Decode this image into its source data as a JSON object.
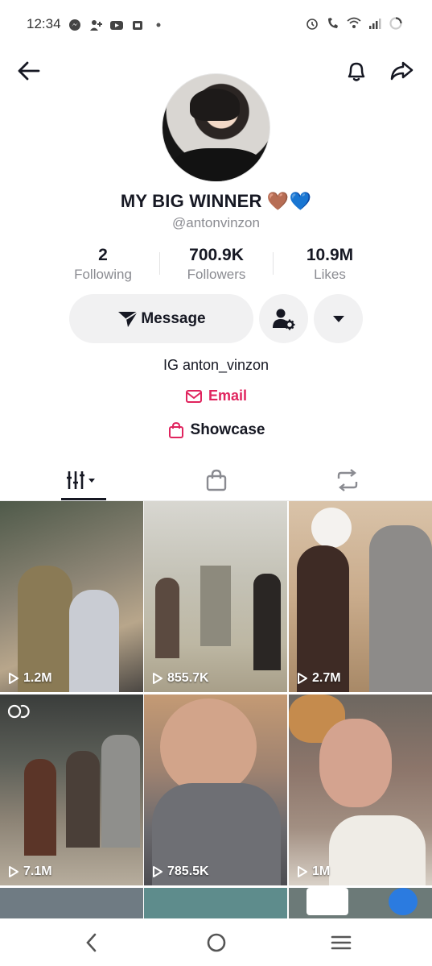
{
  "status_bar": {
    "time": "12:34"
  },
  "profile": {
    "display_name": "MY BIG WINNER 🤎💙",
    "username": "@antonvinzon",
    "bio": "IG anton_vinzon",
    "email_label": "Email",
    "showcase_label": "Showcase"
  },
  "stats": [
    {
      "value": "2",
      "label": "Following"
    },
    {
      "value": "700.9K",
      "label": "Followers"
    },
    {
      "value": "10.9M",
      "label": "Likes"
    }
  ],
  "actions": {
    "message_label": "Message"
  },
  "videos": [
    {
      "views": "1.2M",
      "bg": "#6d6a5e"
    },
    {
      "views": "855.7K",
      "bg": "#c9c6bb"
    },
    {
      "views": "2.7M",
      "bg": "#b59d84"
    },
    {
      "views": "7.1M",
      "bg": "#5a5147"
    },
    {
      "views": "785.5K",
      "bg": "#8a7a6b"
    },
    {
      "views": "1M",
      "bg": "#7a6c65"
    }
  ],
  "colors": {
    "accent": "#e0245e",
    "text": "#161823",
    "muted": "#8a8b91",
    "button_bg": "#f1f1f2"
  }
}
